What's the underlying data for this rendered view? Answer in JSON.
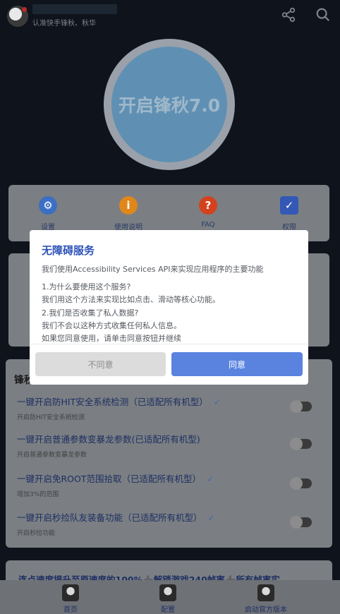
{
  "app": {
    "subtitle": "认准快手锋秋、秋华",
    "start_button_label": "开启锋秋7.0"
  },
  "menu": [
    {
      "label": "设置",
      "icon": "gear-icon",
      "color": "#3b6fc4"
    },
    {
      "label": "使用说明",
      "icon": "info-icon",
      "color": "#e0871b"
    },
    {
      "label": "FAQ",
      "icon": "question-icon",
      "color": "#d4421d"
    },
    {
      "label": "权限",
      "icon": "shield-icon",
      "color": "#3358b5"
    }
  ],
  "settings": {
    "header": "锋秋",
    "rows": [
      {
        "title": "一键开启防HIT安全系统检测（已适配所有机型）",
        "subtitle": "开启防HIT安全系统检测",
        "enabled": false
      },
      {
        "title": "一键开启普通参数变暴龙参数(已适配所有机型)",
        "subtitle": "开启普通参数变暴龙参数",
        "enabled": false
      },
      {
        "title": "一键开启免ROOT范围拾取（已适配所有机型）",
        "subtitle": "增加3%的范围",
        "enabled": false
      },
      {
        "title": "一键开启秒捡队友装备功能（已适配所有机型）",
        "subtitle": "开启秒捡功能",
        "enabled": false
      }
    ],
    "check_mark": "✓"
  },
  "promo": {
    "part1": "连点速度提升至原速度的100%",
    "plus": "➕",
    "part2": "解锁游戏240帧率",
    "part3": "所有帧率实"
  },
  "bottom_nav": [
    {
      "label": "首页"
    },
    {
      "label": "配置"
    },
    {
      "label": "启动官方版本"
    }
  ],
  "dialog": {
    "title": "无障碍服务",
    "intro": "我们使用Accessibility Services API来实现应用程序的主要功能",
    "lines": [
      "1.为什么要使用这个服务?",
      "我们用这个方法来实现比如点击、滑动等核心功能。",
      "2.我们是否收集了私人数据?",
      "我们不会以这种方式收集任何私人信息。",
      "如果您同意使用，请单击同意按钮并继续"
    ],
    "disagree_label": "不同意",
    "agree_label": "同意"
  },
  "colors": {
    "accent": "#5a83e0",
    "title": "#2d53b8"
  }
}
